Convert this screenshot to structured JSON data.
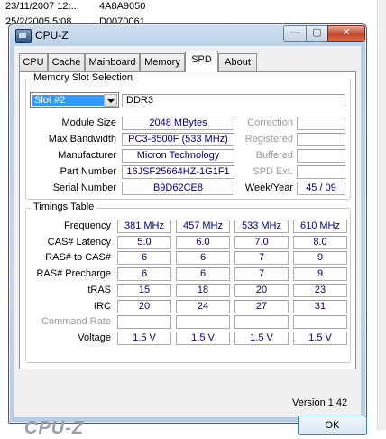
{
  "background": {
    "rows": [
      {
        "date": "23/11/2007 12:...",
        "code": "4A8A9050"
      },
      {
        "date": "25/2/2005 5:08...",
        "code": "D0070061"
      }
    ]
  },
  "window": {
    "title": "CPU-Z",
    "buttons": {
      "minimize": "—",
      "maximize": "▢",
      "close": "✕"
    }
  },
  "tabs": [
    "CPU",
    "Cache",
    "Mainboard",
    "Memory",
    "SPD",
    "About"
  ],
  "active_tab": "SPD",
  "memory_slot": {
    "group_label": "Memory Slot Selection",
    "slot": "Slot #2",
    "type": "DDR3",
    "labels": {
      "module_size": "Module Size",
      "max_bandwidth": "Max Bandwidth",
      "manufacturer": "Manufacturer",
      "part_number": "Part Number",
      "serial_number": "Serial Number",
      "correction": "Correction",
      "registered": "Registered",
      "buffered": "Buffered",
      "spd_ext": "SPD Ext.",
      "week_year": "Week/Year"
    },
    "values": {
      "module_size": "2048 MBytes",
      "max_bandwidth": "PC3-8500F (533 MHz)",
      "manufacturer": "Micron Technology",
      "part_number": "16JSF25664HZ-1G1F1",
      "serial_number": "B9D62CE8",
      "correction": "",
      "registered": "",
      "buffered": "",
      "spd_ext": "",
      "week_year": "45 / 09"
    }
  },
  "timings": {
    "group_label": "Timings Table",
    "rows": [
      {
        "label": "Frequency",
        "values": [
          "381 MHz",
          "457 MHz",
          "533 MHz",
          "610 MHz"
        ]
      },
      {
        "label": "CAS# Latency",
        "values": [
          "5.0",
          "6.0",
          "7.0",
          "8.0"
        ]
      },
      {
        "label": "RAS# to CAS#",
        "values": [
          "6",
          "6",
          "7",
          "9"
        ]
      },
      {
        "label": "RAS# Precharge",
        "values": [
          "6",
          "6",
          "7",
          "9"
        ]
      },
      {
        "label": "tRAS",
        "values": [
          "15",
          "18",
          "20",
          "23"
        ]
      },
      {
        "label": "tRC",
        "values": [
          "20",
          "24",
          "27",
          "31"
        ]
      },
      {
        "label": "Command Rate",
        "values": [
          "",
          "",
          "",
          ""
        ]
      },
      {
        "label": "Voltage",
        "values": [
          "1.5 V",
          "1.5 V",
          "1.5 V",
          "1.5 V"
        ]
      }
    ]
  },
  "footer": {
    "brand": "CPU-Z",
    "version": "Version 1.42",
    "ok_label": "OK"
  }
}
